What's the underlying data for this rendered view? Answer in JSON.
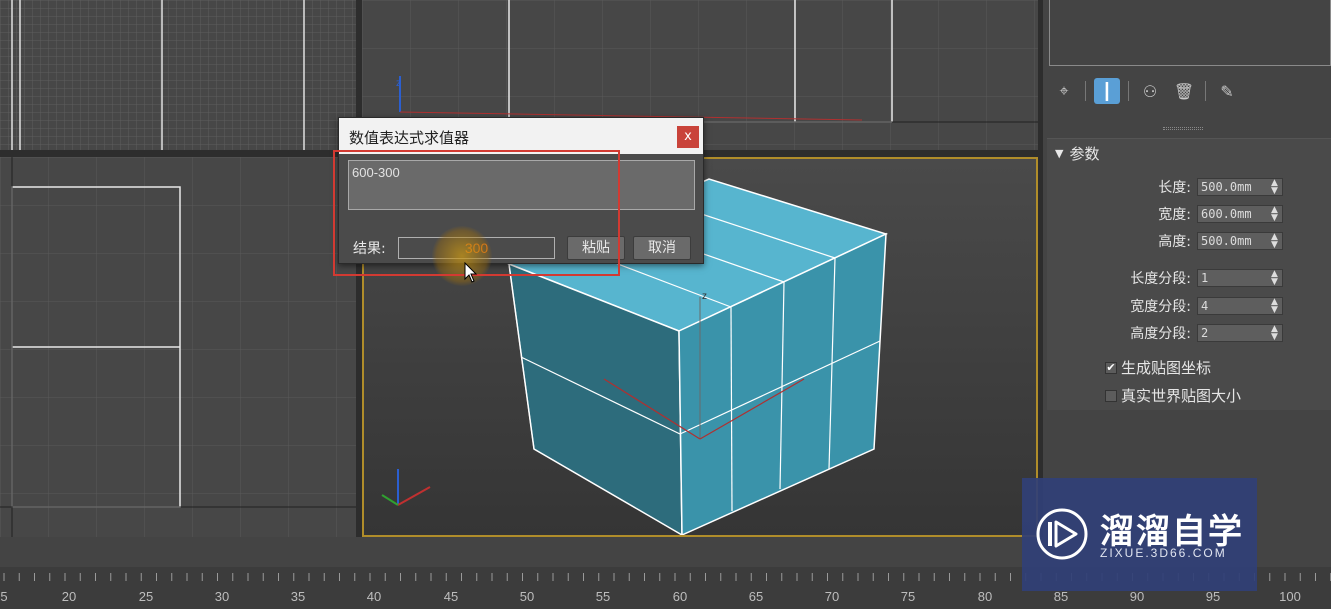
{
  "dialog": {
    "title": "数值表达式求值器",
    "close_label": "x",
    "expression": "600-300",
    "result_label": "结果:",
    "result_value": "300",
    "paste_label": "粘贴",
    "cancel_label": "取消"
  },
  "command_panel": {
    "toolbar_icons": [
      "pin-icon",
      "modifier-stack-icon",
      "show-end-result-icon",
      "delete-icon",
      "configure-icon"
    ],
    "rollout_title": "参数",
    "params": [
      {
        "label": "长度:",
        "value": "500.0mm"
      },
      {
        "label": "宽度:",
        "value": "600.0mm"
      },
      {
        "label": "高度:",
        "value": "500.0mm"
      },
      {
        "label": "长度分段:",
        "value": "1"
      },
      {
        "label": "宽度分段:",
        "value": "4"
      },
      {
        "label": "高度分段:",
        "value": "2"
      }
    ],
    "checkboxes": [
      {
        "label": "生成贴图坐标",
        "checked": true
      },
      {
        "label": "真实世界贴图大小",
        "checked": false
      }
    ]
  },
  "timeline": {
    "ticks": [
      "5",
      "20",
      "25",
      "30",
      "35",
      "40",
      "45",
      "50",
      "55",
      "60",
      "65",
      "70",
      "75",
      "80",
      "85",
      "90",
      "95",
      "100"
    ]
  },
  "watermark": {
    "title": "溜溜自学",
    "subtitle": "ZIXUE.3D66.COM"
  },
  "colors": {
    "box_face": "#4aa8c4",
    "highlight": "#d23a32",
    "result_text": "#f07a20",
    "active_viewport": "#b08d2a"
  }
}
